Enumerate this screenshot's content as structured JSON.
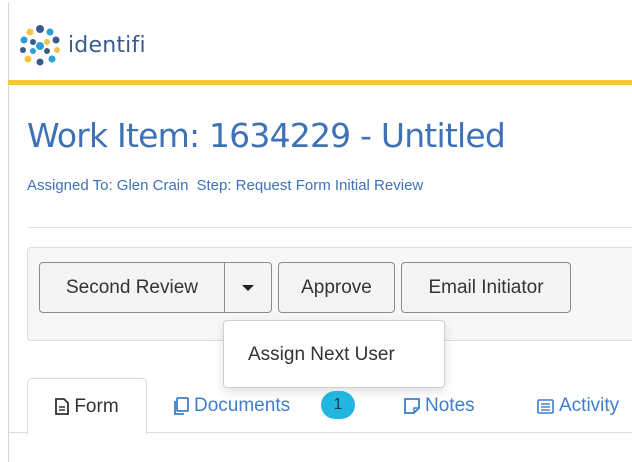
{
  "header": {
    "logo_text": "identifi",
    "accent_color": "#f6c445",
    "brand_color": "#3f72b5"
  },
  "work_item": {
    "title": "Work Item: 1634229 - Untitled",
    "assigned_to": "Assigned To: Glen Crain",
    "step": "Step: Request Form Initial Review"
  },
  "toolbar": {
    "second_review_label": "Second Review",
    "approve_label": "Approve",
    "email_initiator_label": "Email Initiator"
  },
  "dropdown": {
    "items": [
      {
        "label": "Assign Next User"
      }
    ]
  },
  "tabs": [
    {
      "label": "Form",
      "icon": "document-icon",
      "active": true
    },
    {
      "label": "Documents",
      "icon": "copy-icon",
      "badge": "1"
    },
    {
      "label": "Notes",
      "icon": "note-icon"
    },
    {
      "label": "Activity",
      "icon": "list-icon"
    }
  ],
  "colors": {
    "link_blue": "#3f7ecb",
    "badge": "#20b6dd"
  }
}
